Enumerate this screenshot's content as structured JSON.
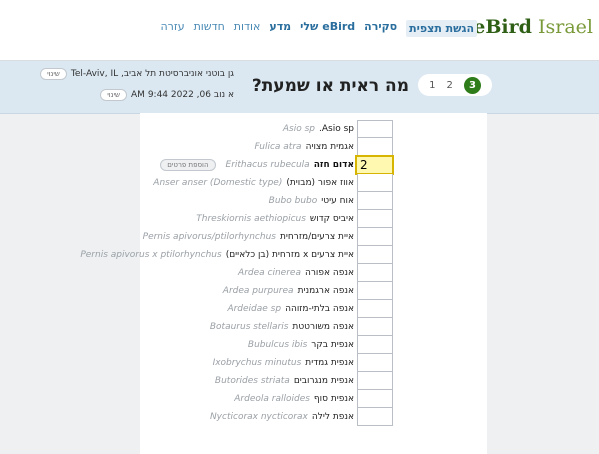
{
  "header": {
    "logo_brand": "eBird",
    "logo_country": "Israel",
    "nav": [
      {
        "label": "הגשת תצפית",
        "style": "active"
      },
      {
        "label": "סקירה",
        "style": "strong"
      },
      {
        "label": "eBird שלי",
        "style": "strong"
      },
      {
        "label": "מדע",
        "style": "strong"
      },
      {
        "label": "אודות",
        "style": "normal"
      },
      {
        "label": "חדשות",
        "style": "normal"
      },
      {
        "label": "עזרה",
        "style": "normal"
      }
    ]
  },
  "infobar": {
    "steps": [
      "1",
      "2",
      "3"
    ],
    "current_step": "3",
    "question": "מה ראית או שמעת?",
    "location": "גן בוטני אוניברסיטת תל אביב, Tel-Aviv, IL",
    "datetime": "א נוב 06, 2022 9:44 AM",
    "change_label": "שינוי"
  },
  "checklist": {
    "details_label": "הוספת פרטים",
    "rows": [
      {
        "heb": "Asio sp.",
        "sci": "Asio sp",
        "qty": "",
        "bold": false
      },
      {
        "heb": "אגמית מצויה",
        "sci": "Fulica atra",
        "qty": "",
        "bold": false
      },
      {
        "heb": "אדום חזה",
        "sci": "Erithacus rubecula",
        "qty": "2",
        "bold": true,
        "details": true
      },
      {
        "heb": "אווז אפור (מבוית)",
        "sci": "Anser anser (Domestic type)",
        "qty": "",
        "bold": false
      },
      {
        "heb": "אוח עיטי",
        "sci": "Bubo bubo",
        "qty": "",
        "bold": false
      },
      {
        "heb": "איביס קדוש",
        "sci": "Threskiornis aethiopicus",
        "qty": "",
        "bold": false
      },
      {
        "heb": "איית צרעים/מזרחית",
        "sci": "Pernis apivorus/ptilorhynchus",
        "qty": "",
        "bold": false
      },
      {
        "heb": "איית צרעים x מזרחית (בן כלאיים)",
        "sci": "Pernis apivorus x ptilorhynchus",
        "qty": "",
        "bold": false
      },
      {
        "heb": "אנפה אפורה",
        "sci": "Ardea cinerea",
        "qty": "",
        "bold": false
      },
      {
        "heb": "אנפה ארגמנית",
        "sci": "Ardea purpurea",
        "qty": "",
        "bold": false
      },
      {
        "heb": "אנפה בלתי-מזוהה",
        "sci": "Ardeidae sp",
        "qty": "",
        "bold": false
      },
      {
        "heb": "אנפה משורטטת",
        "sci": "Botaurus stellaris",
        "qty": "",
        "bold": false
      },
      {
        "heb": "אנפית בקר",
        "sci": "Bubulcus ibis",
        "qty": "",
        "bold": false
      },
      {
        "heb": "אנפית גמדית",
        "sci": "Ixobrychus minutus",
        "qty": "",
        "bold": false
      },
      {
        "heb": "אנפית מנגרובים",
        "sci": "Butorides striata",
        "qty": "",
        "bold": false
      },
      {
        "heb": "אנפית סוף",
        "sci": "Ardeola ralloides",
        "qty": "",
        "bold": false
      },
      {
        "heb": "אנפת לילה",
        "sci": "Nycticorax nycticorax",
        "qty": "",
        "bold": false
      }
    ]
  }
}
